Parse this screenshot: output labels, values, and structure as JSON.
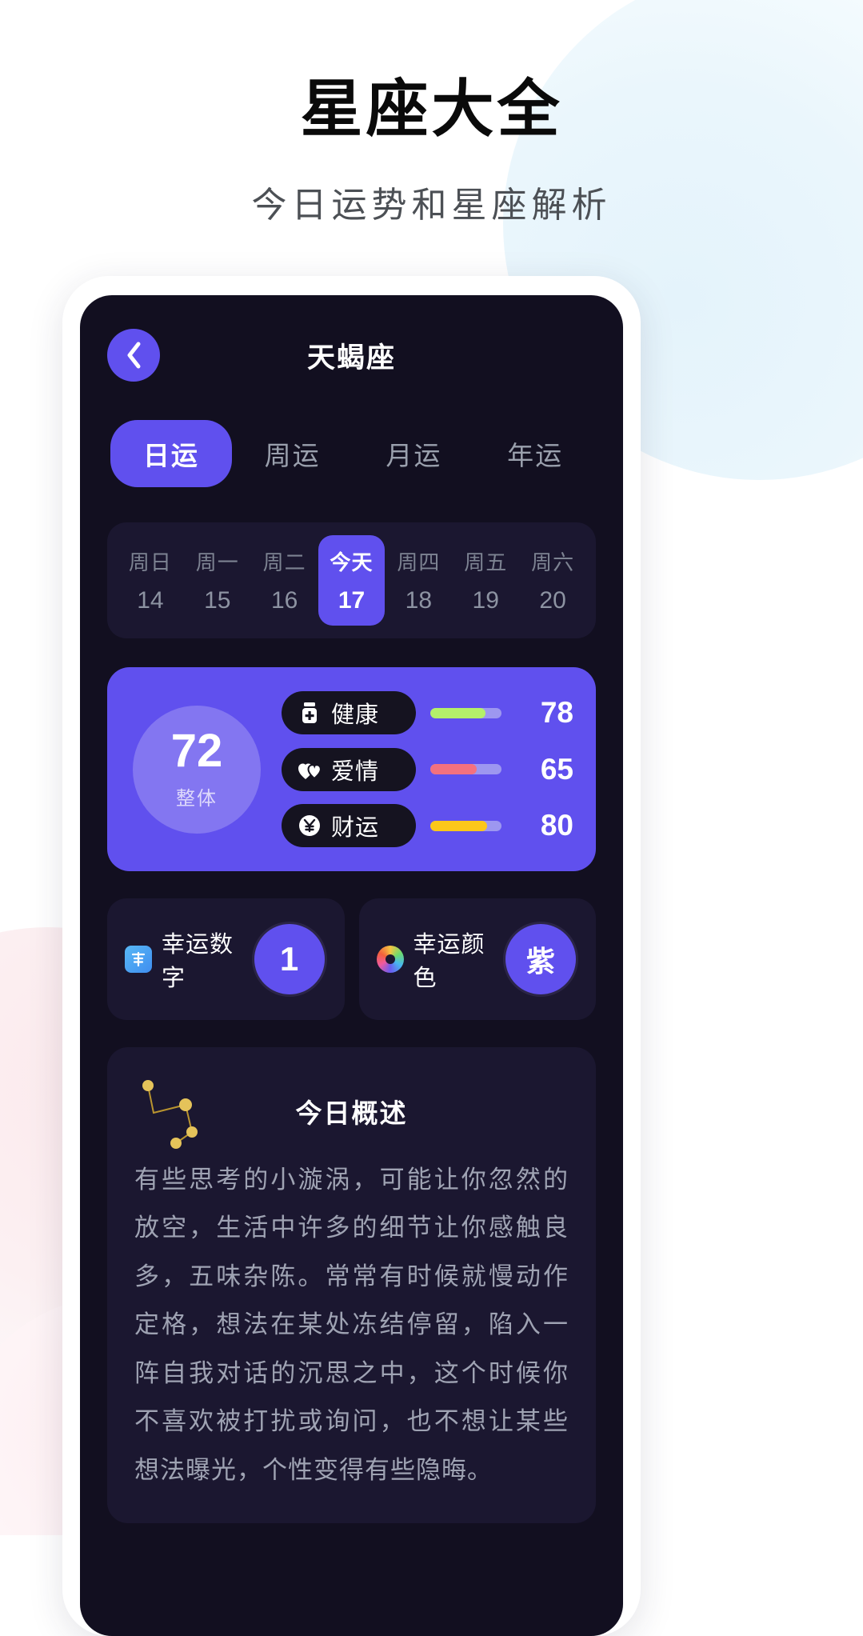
{
  "hero": {
    "title": "星座大全",
    "subtitle": "今日运势和星座解析"
  },
  "app": {
    "header": {
      "back_icon": "chevron-left-icon",
      "title": "天蝎座"
    },
    "tabs": [
      {
        "label": "日运",
        "active": true
      },
      {
        "label": "周运",
        "active": false
      },
      {
        "label": "月运",
        "active": false
      },
      {
        "label": "年运",
        "active": false
      }
    ],
    "dates": [
      {
        "dow": "周日",
        "num": "14",
        "active": false
      },
      {
        "dow": "周一",
        "num": "15",
        "active": false
      },
      {
        "dow": "周二",
        "num": "16",
        "active": false
      },
      {
        "dow": "今天",
        "num": "17",
        "active": true
      },
      {
        "dow": "周四",
        "num": "18",
        "active": false
      },
      {
        "dow": "周五",
        "num": "19",
        "active": false
      },
      {
        "dow": "周六",
        "num": "20",
        "active": false
      }
    ],
    "score": {
      "overall_value": "72",
      "overall_label": "整体",
      "rows": [
        {
          "icon": "pill-bottle-icon",
          "label": "健康",
          "value": "78",
          "color": "#b4f06a"
        },
        {
          "icon": "hearts-icon",
          "label": "爱情",
          "value": "65",
          "color": "#f4717f"
        },
        {
          "icon": "yen-coin-icon",
          "label": "财运",
          "value": "80",
          "color": "#fbc71a"
        }
      ]
    },
    "lucky": [
      {
        "icon": "lucky-char-icon",
        "label": "幸运数字",
        "value": "1"
      },
      {
        "icon": "color-wheel-icon",
        "label": "幸运颜色",
        "value": "紫"
      }
    ],
    "overview": {
      "icon": "constellation-icon",
      "title": "今日概述",
      "text": "有些思考的小漩涡，可能让你忽然的放空，生活中许多的细节让你感触良多，五味杂陈。常常有时候就慢动作定格，想法在某处冻结停留，陷入一阵自我对话的沉思之中，这个时候你不喜欢被打扰或询问，也不想让某些想法曝光，个性变得有些隐晦。"
    }
  },
  "colors": {
    "accent": "#6050ee",
    "screen_bg": "#120f20",
    "card_bg": "#1b1730",
    "chip_bg": "#151320"
  }
}
